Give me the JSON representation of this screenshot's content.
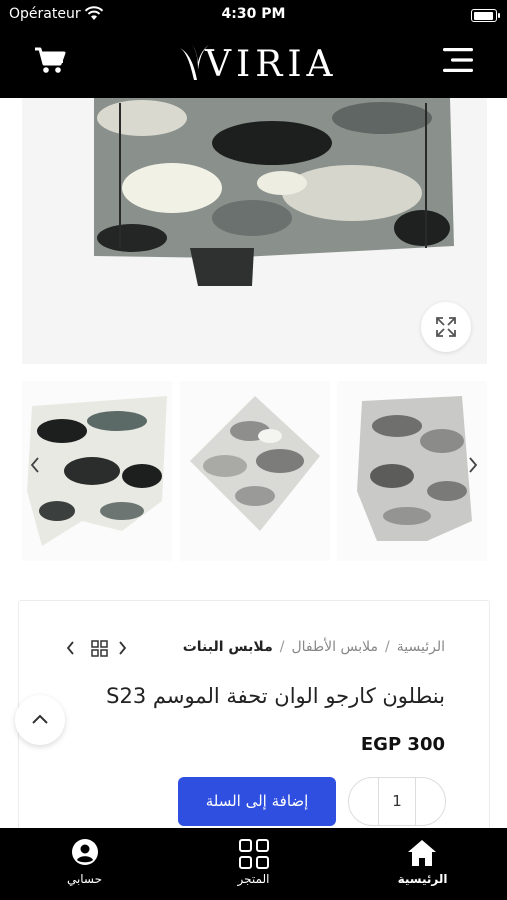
{
  "status_bar": {
    "carrier": "Opérateur",
    "time": "4:30 PM"
  },
  "header": {
    "logo_text": "VIRIA",
    "cart_icon": "cart-icon",
    "menu_icon": "hamburger-menu-icon"
  },
  "gallery": {
    "zoom_icon": "expand-icon",
    "thumbnails": [
      {
        "name": "camo-pants-bw"
      },
      {
        "name": "camo-pants-grey-folded"
      },
      {
        "name": "camo-pants-grey"
      }
    ]
  },
  "product": {
    "breadcrumbs": [
      "الرئيسية",
      "ملابس الأطفال",
      "ملابس البنات"
    ],
    "breadcrumb_separator": "/",
    "title": "بنطلون كارجو الوان تحفة الموسم S23",
    "price": "EGP 300",
    "quantity": "1",
    "add_to_cart_label": "إضافة إلى السلة",
    "accent_color": "#2f4fe0"
  },
  "tab_bar": {
    "tabs": [
      {
        "label": "الرئيسية",
        "icon": "home-icon",
        "active": true
      },
      {
        "label": "المتجر",
        "icon": "grid-icon",
        "active": false
      },
      {
        "label": "حسابي",
        "icon": "account-icon",
        "active": false
      }
    ]
  }
}
